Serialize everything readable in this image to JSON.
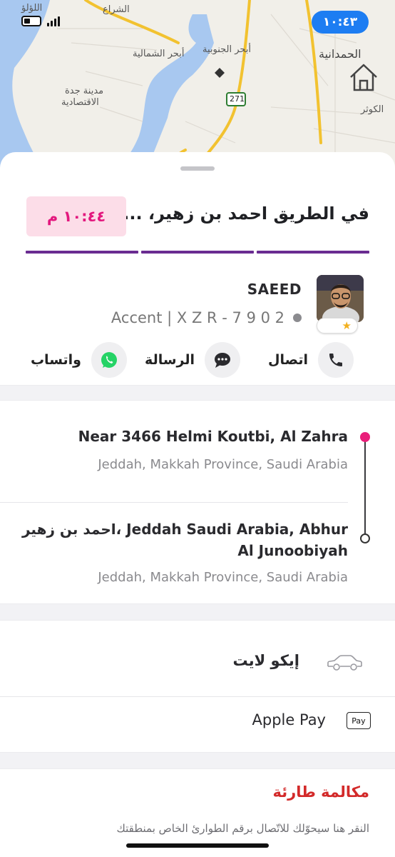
{
  "status_bar": {
    "time": "١٠:٤٣"
  },
  "map": {
    "labels": {
      "l1": "اللؤلؤ",
      "l2": "الشراع",
      "l3": "أبحر الجنوبية",
      "l4": "أبحر الشمالية",
      "l5": "الحمدانية",
      "l6": "مدينة جدة",
      "l7": "الاقتصادية",
      "l8": "الكوثر",
      "road": "271"
    },
    "colors": {
      "water": "#a8c8f0",
      "road": "#f2c230",
      "land": "#f1efe9"
    }
  },
  "trip": {
    "status_title": "في الطريق احمد بن زهير، ...Jedda",
    "eta": "١٠:٤٤ م",
    "progress_segments": 3
  },
  "driver": {
    "name": "SAEED",
    "car": "Accent | X Z R - 7 9 0 2",
    "rating_icon": "star-icon"
  },
  "actions": {
    "call": "اتصال",
    "message": "الرسالة",
    "whatsapp": "واتساب"
  },
  "route": {
    "pickup_line1": "Near 3466 Helmi Koutbi, Al Zahra",
    "pickup_line2": "Jeddah, Makkah Province, Saudi Arabia",
    "dropoff_line1": "احمد بن زهير، Jeddah Saudi Arabia, Abhur",
    "dropoff_line1b": "Al Junoobiyah",
    "dropoff_line2": "Jeddah, Makkah Province, Saudi Arabia"
  },
  "ride": {
    "type": "إيكو لايت",
    "payment": "Apple Pay",
    "payment_badge": "Pay"
  },
  "emergency": {
    "title": "مكالمة طارئة",
    "subtitle": "النقر هنا سيحوّلك للاتّصال برقم الطوارئ الخاص بمنطقتك"
  },
  "colors": {
    "accent": "#6a2c91",
    "eta_bg": "#fcdde8",
    "eta_text": "#e3187e",
    "emergency": "#d32a2a",
    "pickup_pin": "#e91e7a"
  }
}
